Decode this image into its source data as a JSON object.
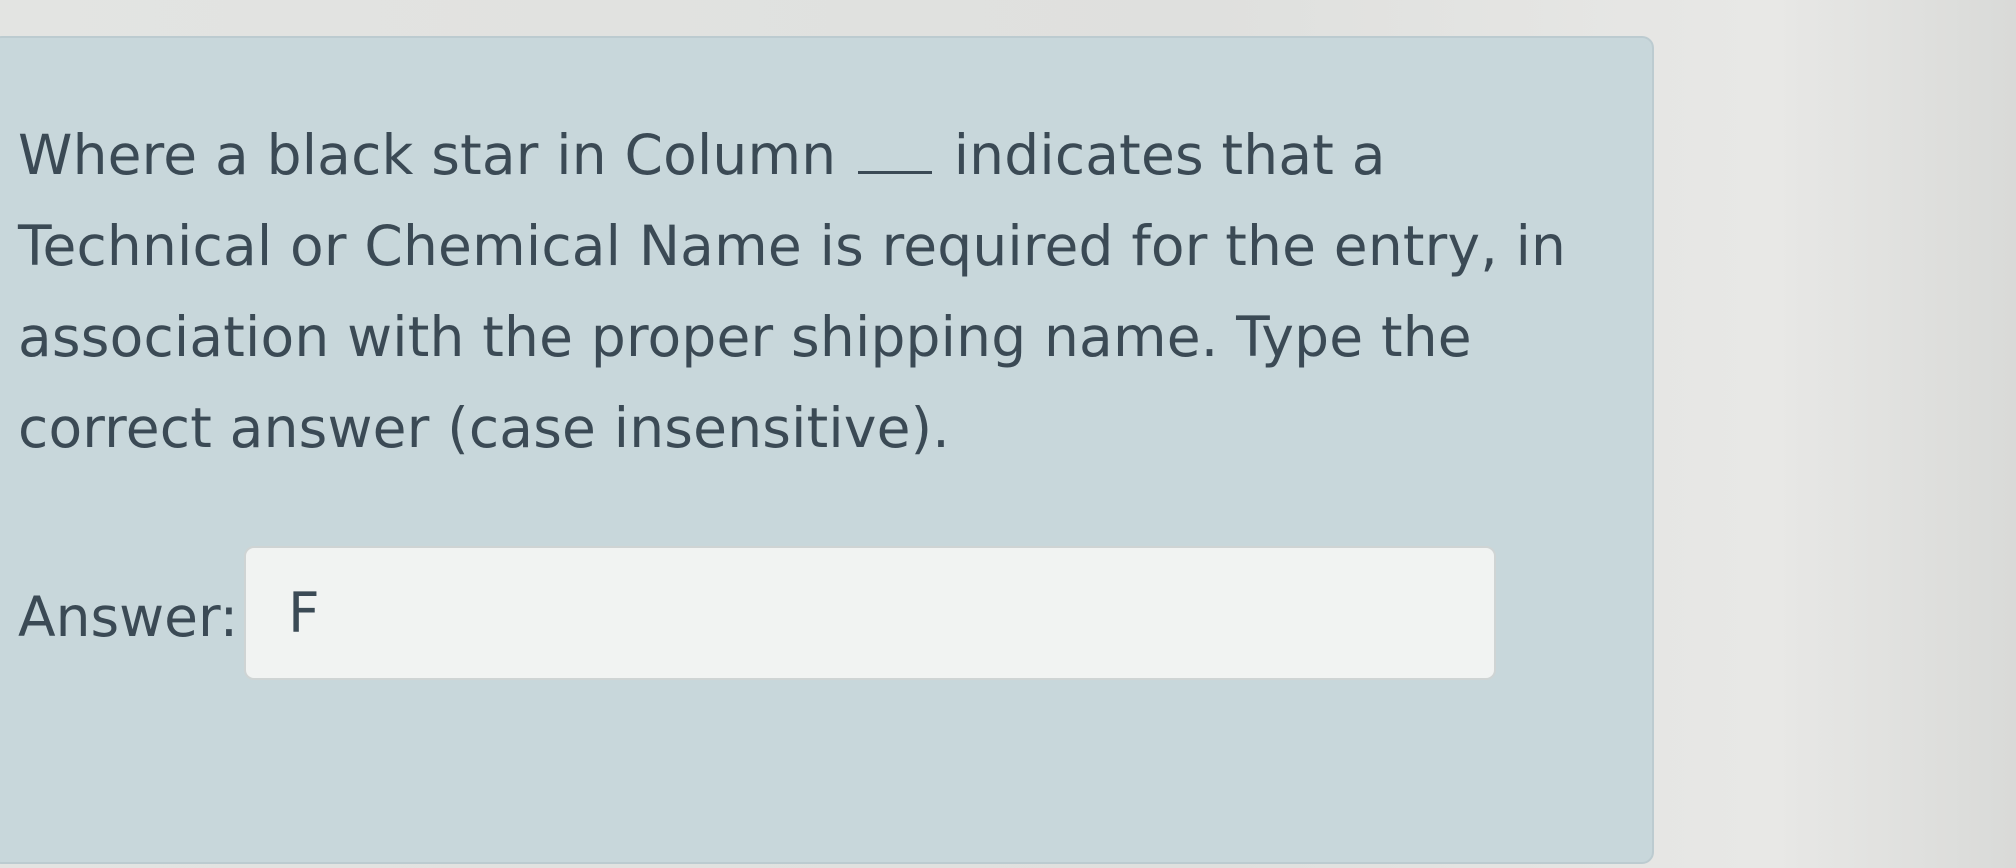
{
  "question": {
    "text_part1": "Where a black star in Column ",
    "text_part2": " indicates that a Technical or Chemical Name is required for the entry, in association with the proper shipping name.  Type the correct answer (case insensitive)."
  },
  "answer": {
    "label": "Answer:",
    "value": "F"
  },
  "colors": {
    "card_background": "#c8d7db",
    "text": "#3b4a55",
    "input_background": "#f1f3f2"
  }
}
